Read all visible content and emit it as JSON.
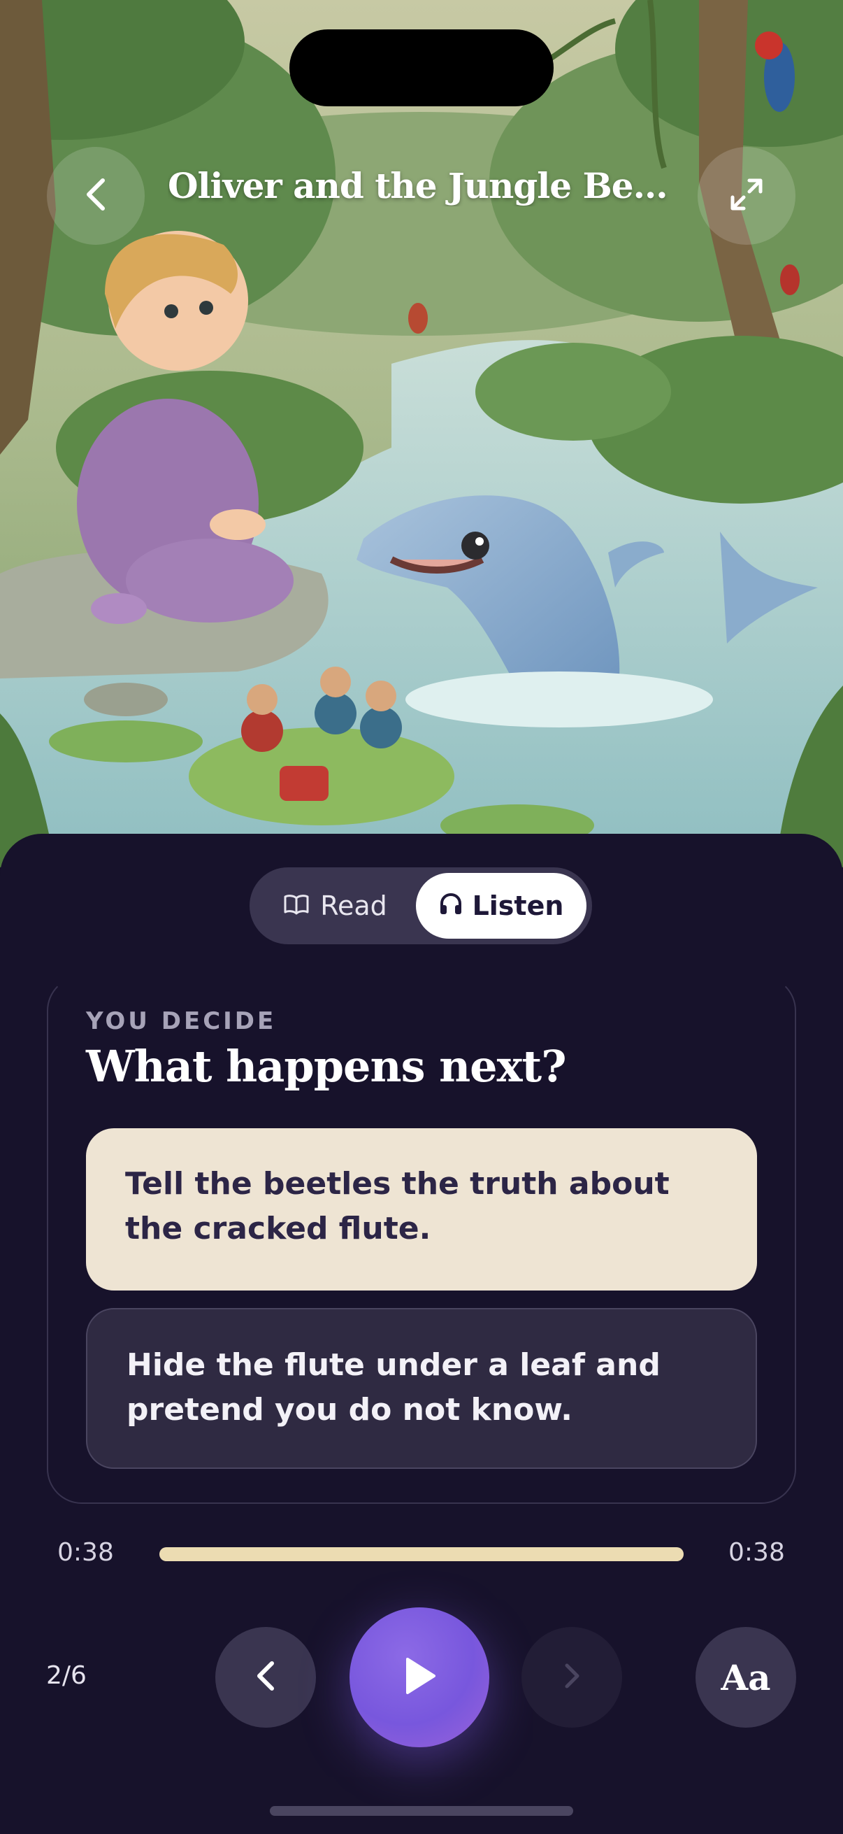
{
  "header": {
    "title": "Oliver and the Jungle Beetl..."
  },
  "mode_toggle": {
    "read_label": "Read",
    "listen_label": "Listen",
    "selected": "Listen"
  },
  "decision": {
    "eyebrow": "YOU DECIDE",
    "title": "What happens next?",
    "choices": [
      {
        "text": "Tell the beetles the truth about the cracked flute.",
        "highlighted": true
      },
      {
        "text": "Hide the flute under a leaf and pretend you do not know.",
        "highlighted": false
      }
    ]
  },
  "player": {
    "current_time": "0:38",
    "total_time": "0:38",
    "progress": 1.0,
    "page_indicator": "2/6",
    "font_button_label": "Aa"
  },
  "icons": {
    "back": "chevron-left-icon",
    "expand": "expand-arrows-icon",
    "read": "book-open-icon",
    "listen": "headphones-icon",
    "prev": "chevron-left-icon",
    "play": "play-icon",
    "next": "chevron-right-icon"
  },
  "colors": {
    "panel_bg": "#17122b",
    "choice_highlight": "#eee4d3",
    "progress_fill": "#ecdcb2",
    "play_button": "#7857dd"
  }
}
